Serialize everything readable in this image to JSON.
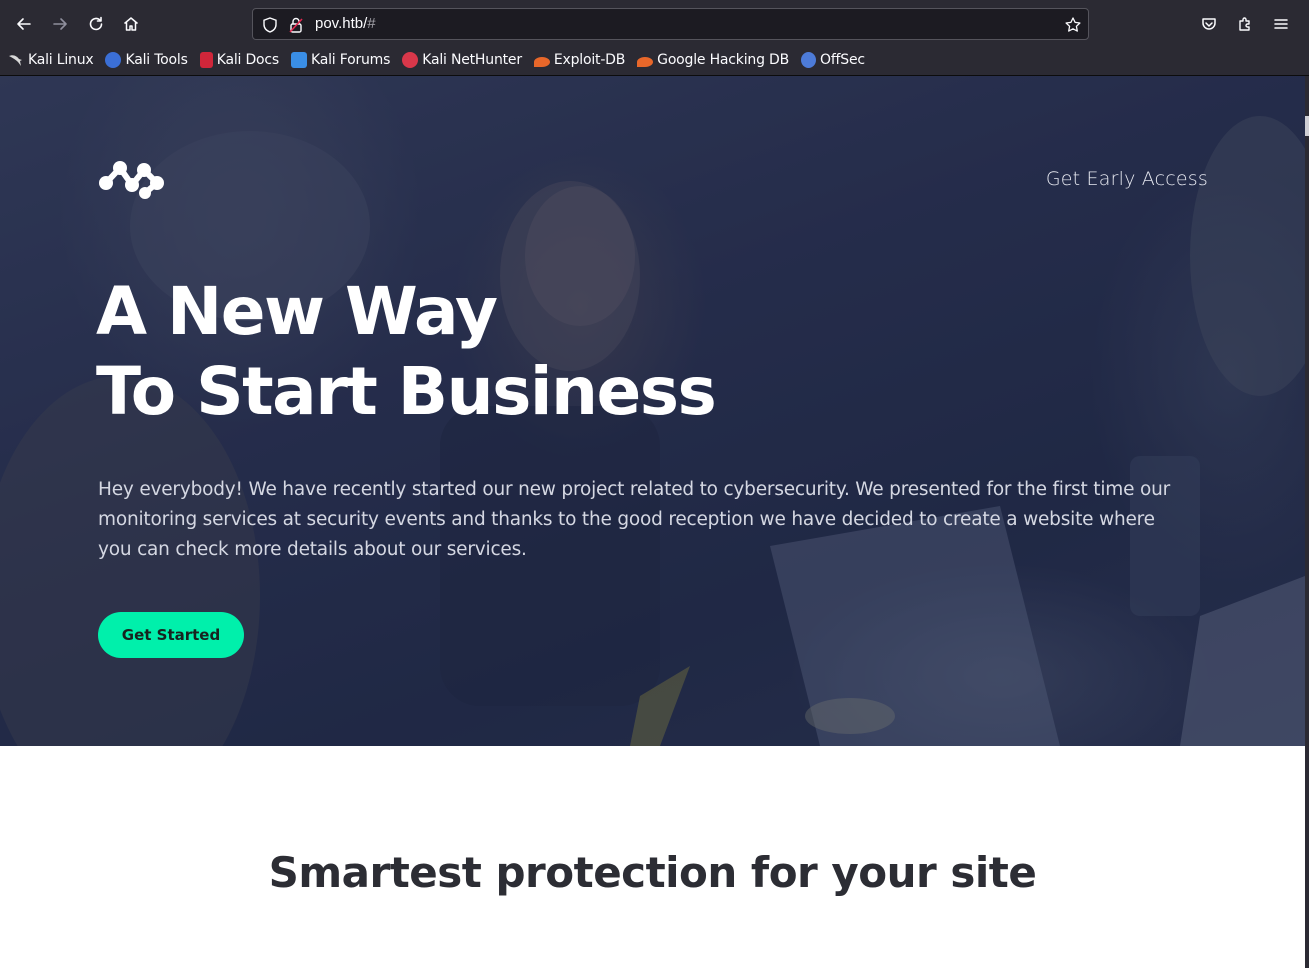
{
  "browser": {
    "url_host": "pov.htb/",
    "url_hash": "#",
    "bookmarks": [
      {
        "label": "Kali Linux",
        "icon": "kali-dragon-icon",
        "color": "#d8d8d8"
      },
      {
        "label": "Kali Tools",
        "icon": "kali-tools-icon",
        "color": "#3b6fd6"
      },
      {
        "label": "Kali Docs",
        "icon": "kali-docs-icon",
        "color": "#d0263a"
      },
      {
        "label": "Kali Forums",
        "icon": "kali-forums-icon",
        "color": "#3a8ee6"
      },
      {
        "label": "Kali NetHunter",
        "icon": "kali-nethunter-icon",
        "color": "#d9374a"
      },
      {
        "label": "Exploit-DB",
        "icon": "exploit-db-icon",
        "color": "#e8672a"
      },
      {
        "label": "Google Hacking DB",
        "icon": "ghdb-icon",
        "color": "#e8672a"
      },
      {
        "label": "OffSec",
        "icon": "offsec-icon",
        "color": "#4d7bd8"
      }
    ]
  },
  "hero": {
    "nav_link": "Get Early Access",
    "headline_line1": "A New Way",
    "headline_line2": "To Start Business",
    "lead": "Hey everybody! We have recently started our new project related to cybersecurity. We presented for the first time our monitoring services at security events and thanks to the good reception we have decided to create a website where you can check more details about our services.",
    "cta_label": "Get Started",
    "accent_color": "#00f0ab"
  },
  "section": {
    "title": "Smartest protection for your site"
  }
}
